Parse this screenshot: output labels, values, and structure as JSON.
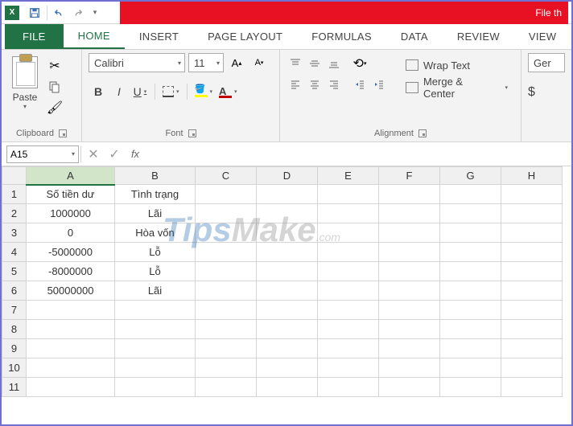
{
  "qat": {
    "title_suffix": "File th"
  },
  "tabs": {
    "file": "FILE",
    "items": [
      "HOME",
      "INSERT",
      "PAGE LAYOUT",
      "FORMULAS",
      "DATA",
      "REVIEW",
      "VIEW"
    ],
    "active": "HOME"
  },
  "ribbon": {
    "clipboard": {
      "paste": "Paste",
      "label": "Clipboard"
    },
    "font": {
      "name": "Calibri",
      "size": "11",
      "bold": "B",
      "italic": "I",
      "underline": "U",
      "label": "Font"
    },
    "alignment": {
      "wrap": "Wrap Text",
      "merge": "Merge & Center",
      "label": "Alignment"
    },
    "number": {
      "format": "Ger",
      "dollar": "$"
    }
  },
  "formula_bar": {
    "name_box": "A15",
    "fx": "fx",
    "formula": ""
  },
  "grid": {
    "columns": [
      "A",
      "B",
      "C",
      "D",
      "E",
      "F",
      "G",
      "H"
    ],
    "rows": [
      "1",
      "2",
      "3",
      "4",
      "5",
      "6",
      "7",
      "8",
      "9",
      "10",
      "11"
    ],
    "data": {
      "A1": "Số tiền dư",
      "B1": "Tình trạng",
      "A2": "1000000",
      "B2": "Lãi",
      "A3": "0",
      "B3": "Hòa vốn",
      "A4": "-5000000",
      "B4": "Lỗ",
      "A5": "-8000000",
      "B5": "Lỗ",
      "A6": "50000000",
      "B6": "Lãi"
    },
    "selected_cell": "A15",
    "selected_column": "A"
  },
  "watermark": {
    "p1": "Tips",
    "p2": "Make",
    "suffix": ".com"
  }
}
